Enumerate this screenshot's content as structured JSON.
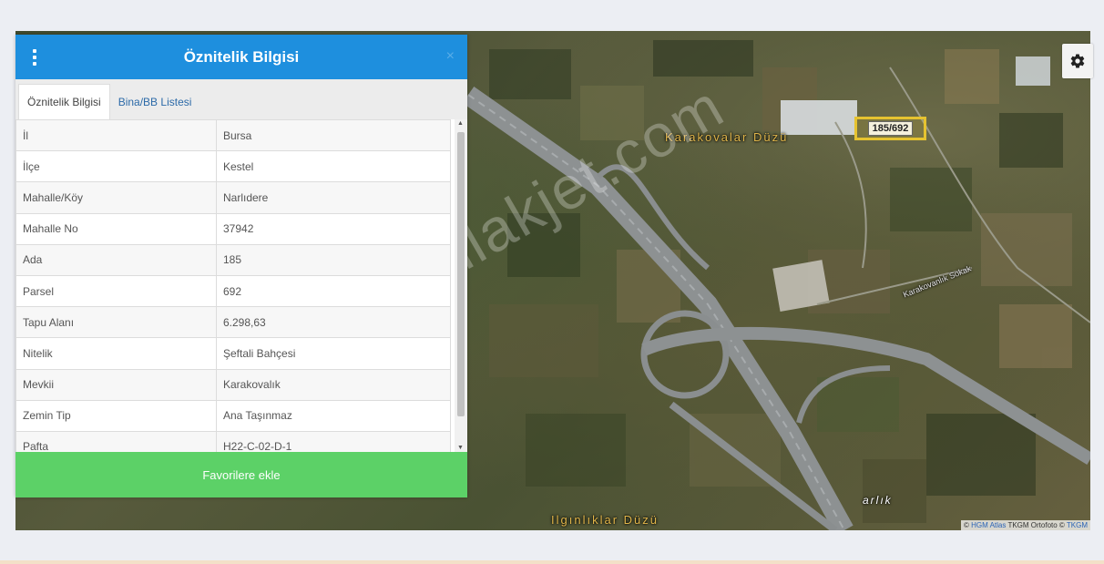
{
  "panel": {
    "title": "Öznitelik Bilgisi",
    "close": "×",
    "tabs": [
      {
        "label": "Öznitelik Bilgisi",
        "active": true
      },
      {
        "label": "Bina/BB Listesi",
        "active": false
      }
    ],
    "rows": [
      {
        "key": "İl",
        "value": "Bursa"
      },
      {
        "key": "İlçe",
        "value": "Kestel"
      },
      {
        "key": "Mahalle/Köy",
        "value": "Narlıdere"
      },
      {
        "key": "Mahalle No",
        "value": "37942"
      },
      {
        "key": "Ada",
        "value": "185"
      },
      {
        "key": "Parsel",
        "value": "692"
      },
      {
        "key": "Tapu Alanı",
        "value": "6.298,63"
      },
      {
        "key": "Nitelik",
        "value": "Şeftali Bahçesi"
      },
      {
        "key": "Mevkii",
        "value": "Karakovalık"
      },
      {
        "key": "Zemin Tip",
        "value": "Ana Taşınmaz"
      },
      {
        "key": "Pafta",
        "value": "H22-C-02-D-1"
      }
    ],
    "favorite_button": "Favorilere ekle"
  },
  "map": {
    "parcel_label": "185/692",
    "labels": {
      "karakovalar": "Karakovalar Düzü",
      "karakovanlik_sokak": "Karakovanlık Sokak",
      "arlik": "arlık",
      "ilginliklar": "Ilgınlıklar Düzü"
    },
    "watermark": "emlakjet.com",
    "attribution": {
      "prefix": "© ",
      "hgm": "HGM Atlas",
      "middle": " TKGM Ortofoto © ",
      "tkgm": "TKGM"
    },
    "colors": {
      "header": "#1e8fde",
      "favorite": "#5cd167",
      "parcel_border": "#e6c330"
    },
    "icons": {
      "settings": "gear-icon",
      "menu": "vertical-dots-icon"
    }
  }
}
